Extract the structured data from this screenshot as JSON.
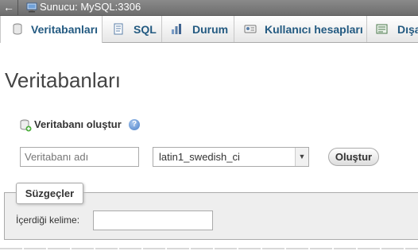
{
  "topbar": {
    "back_glyph": "←",
    "server_label": "Sunucu: MySQL:3306",
    "server_icon": "server-icon"
  },
  "tabs": [
    {
      "label": "Veritabanları",
      "icon": "database-icon",
      "active": true
    },
    {
      "label": "SQL",
      "icon": "sql-icon",
      "active": false
    },
    {
      "label": "Durum",
      "icon": "status-icon",
      "active": false
    },
    {
      "label": "Kullanıcı hesapları",
      "icon": "users-icon",
      "active": false
    },
    {
      "label": "Dışa",
      "icon": "export-icon",
      "active": false
    }
  ],
  "page": {
    "title": "Veritabanları",
    "create_section_label": "Veritabanı oluştur",
    "help_glyph": "?",
    "db_name_placeholder": "Veritabanı adı",
    "collation_value": "latin1_swedish_ci",
    "create_button_label": "Oluştur"
  },
  "filters": {
    "legend": "Süzgeçler",
    "keyword_label": "İçerdiği kelime:",
    "keyword_value": ""
  },
  "colors": {
    "tab_text": "#235a81",
    "topbar_bg": "#7a7a7a",
    "filter_panel_bg": "#eeeeee"
  }
}
